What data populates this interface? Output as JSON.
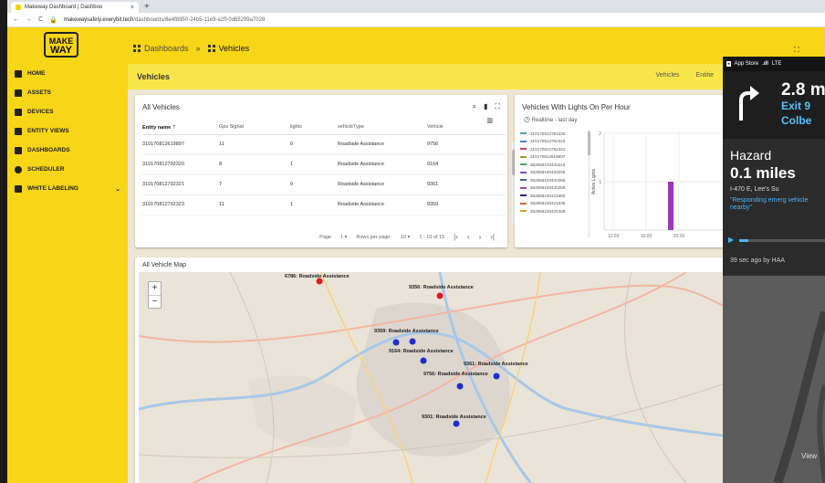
{
  "browser": {
    "tab_title": "Makeway Dashboard | Dashboo",
    "url_host": "makewaysafety.everybit.tech",
    "url_path": "/dashboards/8e4f8950-24b5-11e9-a2ff-0d65299a7028"
  },
  "brand": {
    "logo_line1": "MAKE",
    "logo_line2": "WAY",
    "accent": "#f7d517"
  },
  "breadcrumb": {
    "dashboards": "Dashboards",
    "separator": "»",
    "vehicles": "Vehicles"
  },
  "sidebar": {
    "items": [
      {
        "label": "HOME",
        "icon": "home-icon"
      },
      {
        "label": "ASSETS",
        "icon": "assets-icon"
      },
      {
        "label": "DEVICES",
        "icon": "devices-icon"
      },
      {
        "label": "ENTITY VIEWS",
        "icon": "entity-views-icon"
      },
      {
        "label": "DASHBOARDS",
        "icon": "dashboards-icon"
      },
      {
        "label": "SCHEDULER",
        "icon": "scheduler-icon"
      },
      {
        "label": "WHITE LABELING",
        "icon": "white-labeling-icon"
      }
    ]
  },
  "subheader": {
    "title": "Vehicles",
    "right_1": "Vehicles",
    "right_2": "Entitie"
  },
  "vehicles_table": {
    "title": "All Vehicles",
    "columns": [
      "Entity name",
      "Gps Signal",
      "lights",
      "vehicleType",
      "Vehicle"
    ],
    "rows": [
      [
        "310170812619897",
        "11",
        "0",
        "Roadside Assistance",
        "9756"
      ],
      [
        "310170812792320",
        "8",
        "1",
        "Roadside Assistance",
        "9164"
      ],
      [
        "310170812792321",
        "7",
        "0",
        "Roadside Assistance",
        "9361"
      ],
      [
        "310170812792323",
        "11",
        "1",
        "Roadside Assistance",
        "9359"
      ]
    ],
    "pager": {
      "page_label": "Page",
      "page": "1",
      "rows_label": "Rows per page:",
      "rows": "10",
      "range": "1 - 10 of 15"
    }
  },
  "lights_chart": {
    "title": "Vehicles With Lights On Per Hour",
    "subtitle": "Realtime - last day",
    "legend": [
      {
        "name": "310170812792320",
        "color": "#46a6a6"
      },
      {
        "name": "310170812792323",
        "color": "#4a7fbf"
      },
      {
        "name": "310170812792321",
        "color": "#c94a4a"
      },
      {
        "name": "310170812619897",
        "color": "#9a9a2a"
      },
      {
        "name": "352656100420416",
        "color": "#46a66a"
      },
      {
        "name": "352656100420259",
        "color": "#7a4abf"
      },
      {
        "name": "352656100420366",
        "color": "#3a5f9f"
      },
      {
        "name": "352656100420358",
        "color": "#b04a8a"
      },
      {
        "name": "352656100421660",
        "color": "#2a2a7a"
      },
      {
        "name": "352656100421835",
        "color": "#c06a2a"
      },
      {
        "name": "352656100420309",
        "color": "#d4a62a"
      }
    ]
  },
  "chart_data": {
    "type": "bar",
    "title": "Vehicles With Lights On Per Hour",
    "ylabel": "Active Lights",
    "x_ticks": [
      "12:00",
      "16:00",
      "20:00"
    ],
    "y_ticks": [
      "2",
      "1"
    ],
    "ylim": [
      0,
      2
    ],
    "bars": [
      {
        "x": "19:00",
        "value": 1,
        "color": "#9b37b8"
      }
    ],
    "grid": true
  },
  "map": {
    "title": "All Vehicle Map",
    "zoom_in": "+",
    "zoom_out": "−",
    "markers": [
      {
        "label": "6786: Roadside Assistance",
        "color": "#e01b1b"
      },
      {
        "label": "9356: Roadside Assistance",
        "color": "#e01b1b"
      },
      {
        "label": "9359: Roadside Assistance",
        "color": "#1b2fd1"
      },
      {
        "label": "9164: Roadside Assistance",
        "color": "#1b2fd1"
      },
      {
        "label": "9361: Roadside Assistance",
        "color": "#1b2fd1"
      },
      {
        "label": "9756: Roadside Assistance",
        "color": "#1b2fd1"
      },
      {
        "label": "9301: Roadside Assistance",
        "color": "#1b2fd1"
      }
    ]
  },
  "phone": {
    "status": "App Store",
    "network": "LTE",
    "distance": "2.8 m",
    "exit": "Exit 9",
    "street": "Colbe",
    "alert_type": "Hazard",
    "alert_distance": "0.1 miles",
    "alert_road": "I-470 E, Lee's Su",
    "alert_quote": "\"Responding emerg vehicle nearby\"",
    "alert_progress": 0.1,
    "alert_age": "39 sec ago by HAA",
    "map_label": "View"
  }
}
